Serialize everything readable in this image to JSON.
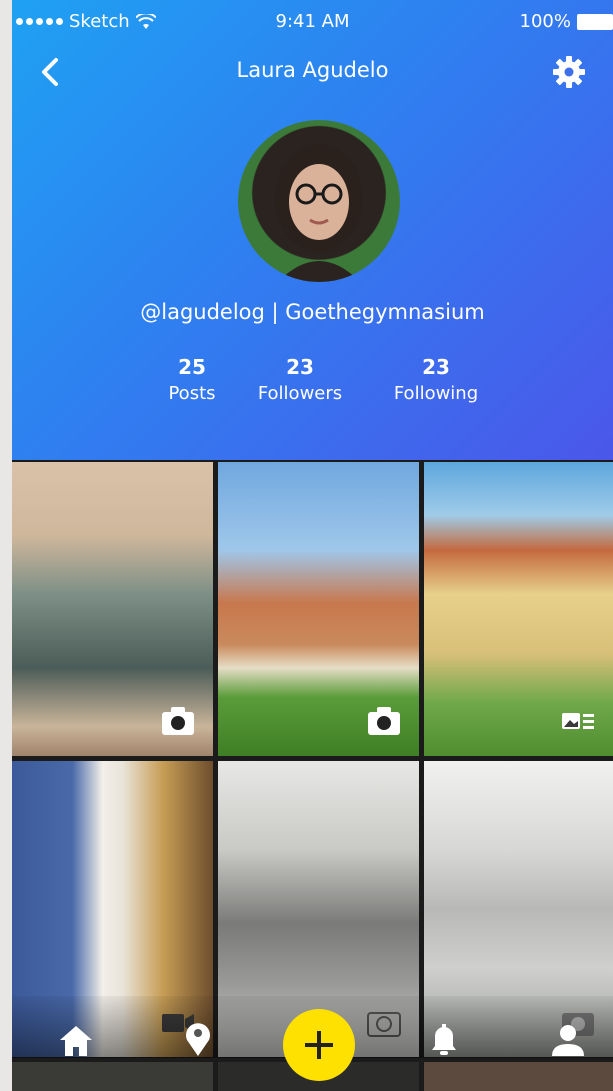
{
  "status_bar": {
    "carrier": "Sketch",
    "time": "9:41 AM",
    "battery": "100%"
  },
  "nav": {
    "back_icon": "chevron-left-icon",
    "title": "Laura Agudelo",
    "settings_icon": "gear-icon"
  },
  "profile": {
    "handle_line": "@lagudelog | Goethegymnasium",
    "stats": [
      {
        "value": "25",
        "label": "Posts"
      },
      {
        "value": "23",
        "label": "Followers"
      },
      {
        "value": "23",
        "label": "Following"
      }
    ]
  },
  "grid": {
    "tiles": [
      {
        "subject": "statue",
        "type_icon": "camera-icon"
      },
      {
        "subject": "tower",
        "type_icon": "camera-icon"
      },
      {
        "subject": "building",
        "type_icon": "gallery-icon"
      },
      {
        "subject": "bust",
        "type_icon": "video-icon"
      },
      {
        "subject": "sketch",
        "type_icon": "camera-icon"
      },
      {
        "subject": "figurines",
        "type_icon": "camera-icon"
      }
    ]
  },
  "tabbar": {
    "icons": [
      "home-icon",
      "map-pin-icon",
      "plus-icon",
      "bell-icon",
      "user-icon"
    ],
    "fab_color": "#ffe100"
  },
  "colors": {
    "gradient_start": "#1fa1f3",
    "gradient_end": "#4b57ea",
    "accent": "#ffe100"
  }
}
